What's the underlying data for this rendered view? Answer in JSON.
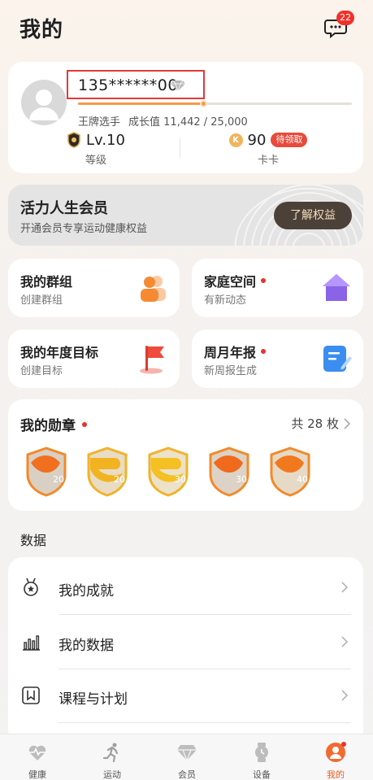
{
  "header": {
    "title": "我的",
    "message_count": "22"
  },
  "profile": {
    "username": "135******00",
    "level_progress": 0.457,
    "rank_title": "王牌选手",
    "growth_text": "成长值 11,442 / 25,000",
    "level_value": "Lv.10",
    "level_label": "等级",
    "card_value": "90",
    "card_claim": "待领取",
    "card_label": "卡卡"
  },
  "membership": {
    "title": "活力人生会员",
    "subtitle": "开通会员专享运动健康权益",
    "button": "了解权益"
  },
  "tiles": [
    {
      "title": "我的群组",
      "subtitle": "创建群组",
      "dot": false
    },
    {
      "title": "家庭空间",
      "subtitle": "有新动态",
      "dot": true
    },
    {
      "title": "我的年度目标",
      "subtitle": "创建目标",
      "dot": false
    },
    {
      "title": "周月年报",
      "subtitle": "新周报生成",
      "dot": true
    }
  ],
  "medals": {
    "title": "我的勋章",
    "count_text": "共 28 枚",
    "items": [
      "20",
      "20",
      "30",
      "30",
      "40"
    ]
  },
  "data_section": {
    "heading": "数据",
    "rows": [
      {
        "label": "我的成就",
        "icon": "medal-icon"
      },
      {
        "label": "我的数据",
        "icon": "bar-chart-icon"
      },
      {
        "label": "课程与计划",
        "icon": "bookmark-icon"
      }
    ]
  },
  "tabs": [
    {
      "label": "健康",
      "icon": "heart-pulse-icon"
    },
    {
      "label": "运动",
      "icon": "runner-icon"
    },
    {
      "label": "会员",
      "icon": "diamond-icon"
    },
    {
      "label": "设备",
      "icon": "watch-icon"
    },
    {
      "label": "我的",
      "icon": "user-icon",
      "active": true
    }
  ],
  "colors": {
    "accent": "#f39b4a",
    "badge_red": "#e8322d",
    "member_btn": "#4c4138",
    "active_tab": "#f05a24"
  }
}
